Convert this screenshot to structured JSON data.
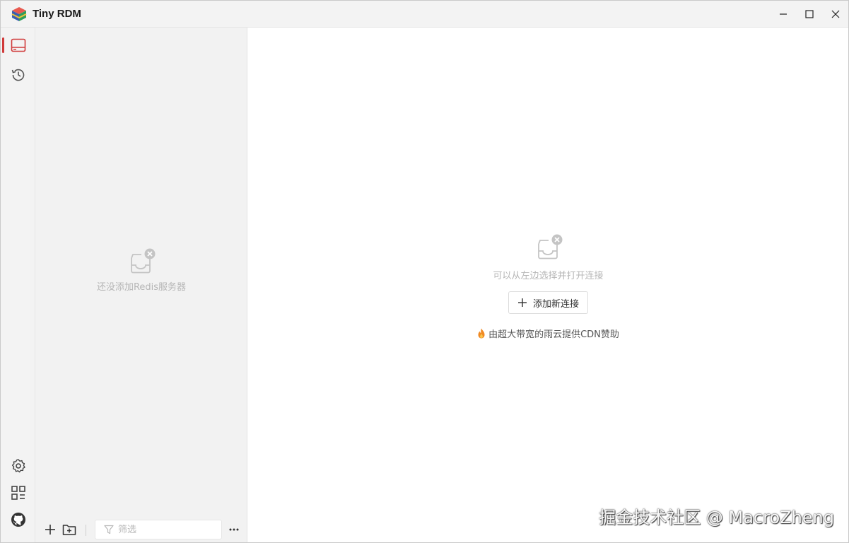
{
  "app": {
    "title": "Tiny RDM",
    "brand_color": "#d03a3a"
  },
  "window_controls": {
    "minimize_icon": "minimize-icon",
    "maximize_icon": "maximize-icon",
    "close_icon": "close-icon"
  },
  "rail": {
    "top_items": [
      {
        "icon": "server-panel-icon",
        "active": true
      },
      {
        "icon": "history-icon",
        "active": false
      }
    ],
    "bottom_items": [
      {
        "icon": "settings-gear-icon"
      },
      {
        "icon": "apps-grid-icon"
      },
      {
        "icon": "github-icon"
      }
    ]
  },
  "connections": {
    "empty_text": "还没添加Redis服务器",
    "filter_placeholder": "筛选",
    "toolbar_icons": [
      "plus-icon",
      "new-folder-icon",
      "more-dots-icon"
    ]
  },
  "main": {
    "empty_text": "可以从左边选择并打开连接",
    "add_button_label": "添加新连接",
    "sponsor_text": "由超大带宽的雨云提供CDN赞助"
  },
  "watermark": {
    "text": "掘金技术社区 @ MacroZheng"
  }
}
